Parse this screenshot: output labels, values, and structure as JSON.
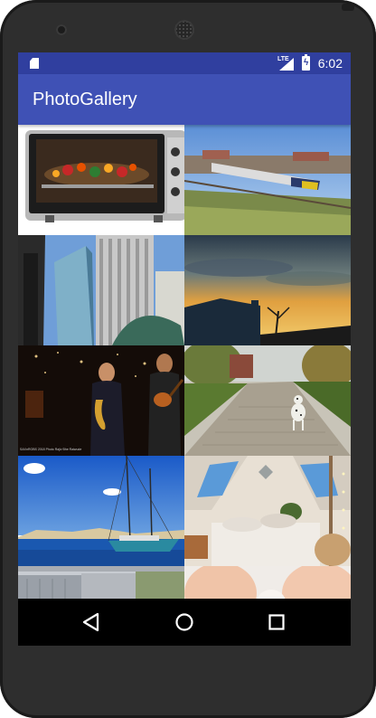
{
  "status_bar": {
    "network_label": "LTE",
    "time": "6:02",
    "background": "#303f9f",
    "icons": [
      "sd-card-icon",
      "signal-icon",
      "battery-charging-icon"
    ]
  },
  "app_bar": {
    "title": "PhotoGallery",
    "background": "#3f51b5"
  },
  "gallery": {
    "columns": 2,
    "photos": [
      {
        "subject": "toaster oven with food"
      },
      {
        "subject": "passenger train in countryside"
      },
      {
        "subject": "glass skyscrapers"
      },
      {
        "subject": "sunset sky over house"
      },
      {
        "subject": "jazz musicians on stage",
        "caption": "SAXnROBS 2018 Photo Rajiv Bhe Raiwude"
      },
      {
        "subject": "dalmatian on cobblestone path"
      },
      {
        "subject": "sailing ship on blue sea"
      },
      {
        "subject": "attic bedroom with skylights"
      },
      {
        "subject": "security camera still"
      },
      {
        "subject": "close-up skin tone"
      }
    ]
  },
  "nav_bar": {
    "buttons": [
      "back-icon",
      "home-icon",
      "recents-icon"
    ]
  }
}
